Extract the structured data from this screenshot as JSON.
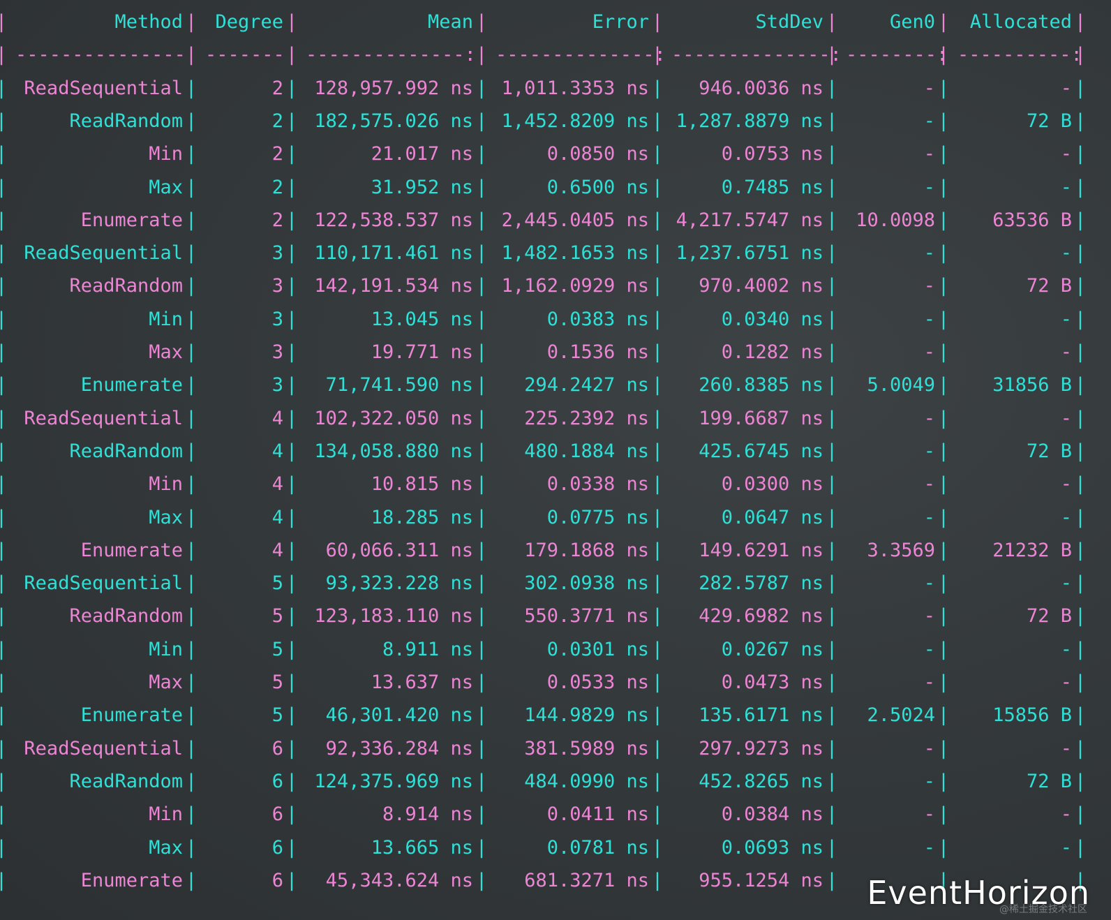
{
  "colors": {
    "cyan": "#2ee0d6",
    "pink": "#ec85d4"
  },
  "header": [
    "Method",
    "Degree",
    "Mean",
    "Error",
    "StdDev",
    "Gen0",
    "Allocated"
  ],
  "separator": [
    "---------------",
    "-------",
    "--------------:",
    "--------------:",
    "--------------:",
    "--------:",
    "----------:"
  ],
  "rows": [
    [
      "ReadSequential",
      "2",
      "128,957.992 ns",
      "1,011.3353 ns",
      "946.0036 ns",
      "-",
      "-"
    ],
    [
      "ReadRandom",
      "2",
      "182,575.026 ns",
      "1,452.8209 ns",
      "1,287.8879 ns",
      "-",
      "72 B"
    ],
    [
      "Min",
      "2",
      "21.017 ns",
      "0.0850 ns",
      "0.0753 ns",
      "-",
      "-"
    ],
    [
      "Max",
      "2",
      "31.952 ns",
      "0.6500 ns",
      "0.7485 ns",
      "-",
      "-"
    ],
    [
      "Enumerate",
      "2",
      "122,538.537 ns",
      "2,445.0405 ns",
      "4,217.5747 ns",
      "10.0098",
      "63536 B"
    ],
    [
      "ReadSequential",
      "3",
      "110,171.461 ns",
      "1,482.1653 ns",
      "1,237.6751 ns",
      "-",
      "-"
    ],
    [
      "ReadRandom",
      "3",
      "142,191.534 ns",
      "1,162.0929 ns",
      "970.4002 ns",
      "-",
      "72 B"
    ],
    [
      "Min",
      "3",
      "13.045 ns",
      "0.0383 ns",
      "0.0340 ns",
      "-",
      "-"
    ],
    [
      "Max",
      "3",
      "19.771 ns",
      "0.1536 ns",
      "0.1282 ns",
      "-",
      "-"
    ],
    [
      "Enumerate",
      "3",
      "71,741.590 ns",
      "294.2427 ns",
      "260.8385 ns",
      "5.0049",
      "31856 B"
    ],
    [
      "ReadSequential",
      "4",
      "102,322.050 ns",
      "225.2392 ns",
      "199.6687 ns",
      "-",
      "-"
    ],
    [
      "ReadRandom",
      "4",
      "134,058.880 ns",
      "480.1884 ns",
      "425.6745 ns",
      "-",
      "72 B"
    ],
    [
      "Min",
      "4",
      "10.815 ns",
      "0.0338 ns",
      "0.0300 ns",
      "-",
      "-"
    ],
    [
      "Max",
      "4",
      "18.285 ns",
      "0.0775 ns",
      "0.0647 ns",
      "-",
      "-"
    ],
    [
      "Enumerate",
      "4",
      "60,066.311 ns",
      "179.1868 ns",
      "149.6291 ns",
      "3.3569",
      "21232 B"
    ],
    [
      "ReadSequential",
      "5",
      "93,323.228 ns",
      "302.0938 ns",
      "282.5787 ns",
      "-",
      "-"
    ],
    [
      "ReadRandom",
      "5",
      "123,183.110 ns",
      "550.3771 ns",
      "429.6982 ns",
      "-",
      "72 B"
    ],
    [
      "Min",
      "5",
      "8.911 ns",
      "0.0301 ns",
      "0.0267 ns",
      "-",
      "-"
    ],
    [
      "Max",
      "5",
      "13.637 ns",
      "0.0533 ns",
      "0.0473 ns",
      "-",
      "-"
    ],
    [
      "Enumerate",
      "5",
      "46,301.420 ns",
      "144.9829 ns",
      "135.6171 ns",
      "2.5024",
      "15856 B"
    ],
    [
      "ReadSequential",
      "6",
      "92,336.284 ns",
      "381.5989 ns",
      "297.9273 ns",
      "-",
      "-"
    ],
    [
      "ReadRandom",
      "6",
      "124,375.969 ns",
      "484.0990 ns",
      "452.8265 ns",
      "-",
      "72 B"
    ],
    [
      "Min",
      "6",
      "8.914 ns",
      "0.0411 ns",
      "0.0384 ns",
      "-",
      "-"
    ],
    [
      "Max",
      "6",
      "13.665 ns",
      "0.0781 ns",
      "0.0693 ns",
      "-",
      "-"
    ],
    [
      "Enumerate",
      "6",
      "45,343.624 ns",
      "681.3271 ns",
      "955.1254 ns",
      "",
      ""
    ]
  ],
  "watermark": {
    "brand": "EventHorizon",
    "credit": "@稀土掘金技术社区"
  }
}
